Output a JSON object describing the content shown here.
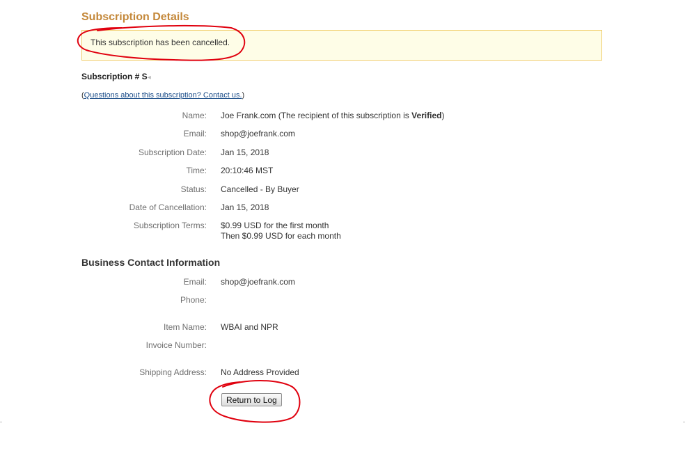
{
  "page": {
    "title": "Subscription Details",
    "notice": "This subscription has been cancelled.",
    "subscription_number_label": "Subscription # S",
    "subscription_number_fade": "◂",
    "questions": {
      "open": "(",
      "link": "Questions about this subscription? Contact us.",
      "close": ")"
    }
  },
  "details": [
    {
      "label": "Name:",
      "value_prefix": "Joe Frank.com (The recipient of this subscription is ",
      "value_bold": "Verified",
      "value_suffix": ")"
    },
    {
      "label": "Email:",
      "value": "shop@joefrank.com"
    },
    {
      "label": "Subscription Date:",
      "value": "Jan 15, 2018"
    },
    {
      "label": "Time:",
      "value": "20:10:46 MST"
    },
    {
      "label": "Status:",
      "value": "Cancelled - By Buyer"
    },
    {
      "label": "Date of Cancellation:",
      "value": "Jan 15, 2018"
    },
    {
      "label": "Subscription Terms:",
      "value_line1": "$0.99 USD for the first month",
      "value_line2": "Then $0.99 USD for each month"
    }
  ],
  "business": {
    "title": "Business Contact Information",
    "rows": [
      {
        "label": "Email:",
        "value": "shop@joefrank.com"
      },
      {
        "label": "Phone:",
        "value": ""
      },
      {
        "label": "Item Name:",
        "value": "WBAI and NPR"
      },
      {
        "label": "Invoice Number:",
        "value": ""
      },
      {
        "label": "Shipping Address:",
        "value": "No Address Provided"
      }
    ]
  },
  "actions": {
    "return_label": "Return to Log"
  },
  "colors": {
    "title": "#c4883a",
    "notice_bg": "#fefde7",
    "notice_border": "#f0cd6a",
    "link": "#1c4e8a",
    "annotation": "#e0000e"
  }
}
